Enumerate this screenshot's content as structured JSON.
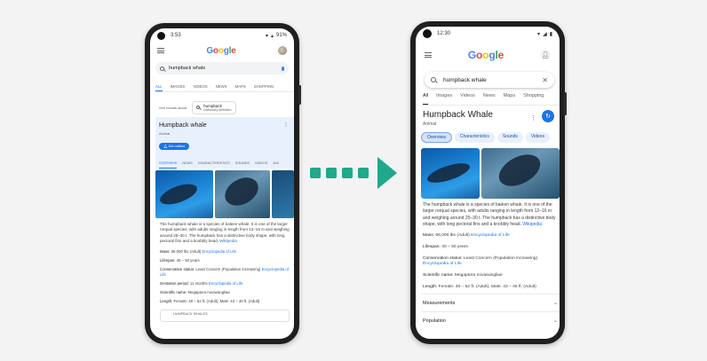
{
  "left_phone": {
    "status_time": "3:53",
    "status_battery": "91%",
    "logo": "Google",
    "search_query": "humpback whale",
    "tabs": [
      "ALL",
      "IMAGES",
      "VIDEOS",
      "NEWS",
      "MAPS",
      "SHOPPING"
    ],
    "see_results_label": "See results about",
    "chip_title": "humpback",
    "chip_subtitle": "Dictionary definition",
    "kp_title": "Humpback whale",
    "kp_subtitle": "Animal",
    "follow_label": "Get notified",
    "kp_tabs": [
      "OVERVIEW",
      "NEWS",
      "CHARACTERISTICS",
      "SOUNDS",
      "VIDEOS",
      "ANI"
    ],
    "description": "The humpback whale is a species of baleen whale. It is one of the larger rorqual species, with adults ranging in length from 12–16 m and weighing around 25–30 t. The humpback has a distinctive body shape, with long pectoral fins and a knobbly head.",
    "desc_link": "Wikipedia",
    "facts": [
      {
        "label": "Mass:",
        "value": " 66,000 lbs (Adult) ",
        "link": "Encyclopedia of Life"
      },
      {
        "label": "Lifespan:",
        "value": " 40 – 50 years",
        "link": ""
      },
      {
        "label": "Conservation status:",
        "value": " Least Concern (Population increasing) ",
        "link": "Encyclopedia of Life"
      },
      {
        "label": "Gestation period:",
        "value": " 11 months ",
        "link": "Encyclopedia of Life"
      },
      {
        "label": "Scientific name:",
        "value": " Megaptera novaeangliae",
        "link": ""
      },
      {
        "label": "Length:",
        "value": " Female: 49 – 52 ft. (Adult), Male: 43 – 46 ft. (Adult)",
        "link": ""
      }
    ],
    "card_label": "HUMPBACK WHALES"
  },
  "right_phone": {
    "status_time": "12:30",
    "logo": "Google",
    "search_query": "humpback whale",
    "tabs": [
      "All",
      "Images",
      "Videos",
      "News",
      "Maps",
      "Shopping"
    ],
    "kp_title": "Humpback Whale",
    "kp_subtitle": "Animal",
    "chips": [
      "Overview",
      "Characteristics",
      "Sounds",
      "Videos"
    ],
    "description": "The humpback whale is a species of baleen whale. It is one of the larger rorqual species, with adults ranging in length from 12–16 m and weighing around 25–30 t. The humpback has a distinctive body shape, with long pectoral fins and a knobbly head.",
    "desc_link": "Wikipedia",
    "facts": [
      {
        "label": "Mass:",
        "value": " 66,000 lbs (Adult) ",
        "link": "Encyclopedia of Life"
      },
      {
        "label": "Lifespan:",
        "value": " 40 – 50 years",
        "link": ""
      },
      {
        "label": "Conservation status:",
        "value": " Least Concern (Population increasing) ",
        "link": "Encyclopedia of Life"
      },
      {
        "label": "Scientific name:",
        "value": " Megaptera novaeangliae",
        "link": ""
      },
      {
        "label": "Length:",
        "value": " Female: 49 – 52 ft. (Adult), Male: 43 – 46 ft. (Adult)",
        "link": ""
      }
    ],
    "accordions": [
      "Measurements",
      "Population"
    ]
  },
  "colors": {
    "arrow": "#1fa88a",
    "link": "#1a73e8"
  }
}
